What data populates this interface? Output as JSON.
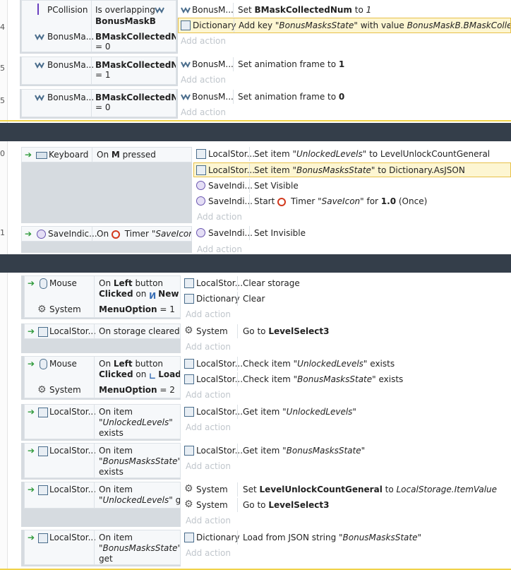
{
  "line_numbers": [
    "4",
    "5",
    "5",
    "0",
    "1"
  ],
  "blocks": [
    {
      "id": "b1",
      "conditions": [
        {
          "object": "PCollision",
          "text": "Is overlapping",
          "text2": "BonusMaskB"
        },
        {
          "object": "BonusMa...",
          "text": "BMaskCollectedNum",
          "text2": "= 0"
        }
      ],
      "actions": [
        {
          "object": "BonusM...",
          "text_pre": "Set ",
          "bold": "BMaskCollectedNum",
          "text_mid": " to ",
          "italic": "1"
        },
        {
          "object": "Dictionary",
          "text_pre": "Add key ",
          "italic": "\"BonusMasksState\"",
          "text_mid": " with value ",
          "italic2": "BonusMaskB.BMaskCollectedNum"
        }
      ]
    },
    {
      "id": "b2",
      "conditions": [
        {
          "object": "BonusMa...",
          "text": "BMaskCollectedNum",
          "text2": "= 1"
        }
      ],
      "actions": [
        {
          "object": "BonusM...",
          "text_pre": "Set animation frame to ",
          "bold": "1"
        }
      ]
    },
    {
      "id": "b3",
      "conditions": [
        {
          "object": "BonusMa...",
          "text": "BMaskCollectedNum",
          "text2": "= 0"
        }
      ],
      "actions": [
        {
          "object": "BonusM...",
          "text_pre": "Set animation frame to ",
          "bold": "0"
        }
      ]
    },
    {
      "id": "b4",
      "conditions": [
        {
          "object": "Keyboard",
          "text": "On ",
          "bold": "M",
          "text2": " pressed"
        }
      ],
      "actions": [
        {
          "object": "LocalStor...",
          "text_pre": "Set item ",
          "italic": "\"UnlockedLevels\"",
          "text_mid": " to LevelUnlockCountGeneral"
        },
        {
          "object": "LocalStor...",
          "text_pre": "Set item ",
          "italic": "\"BonusMasksState\"",
          "text_mid": " to Dictionary.AsJSON"
        },
        {
          "object": "SaveIndi...",
          "text_pre": "Set Visible"
        },
        {
          "object": "SaveIndi...",
          "text_pre": "Start ",
          "text_mid": " Timer ",
          "italic": "\"SaveIcon\"",
          "text_post": " for ",
          "bold": "1.0",
          "text_end": " (Once)"
        }
      ]
    },
    {
      "id": "b5",
      "conditions": [
        {
          "object": "SaveIndic...",
          "text": "On ",
          "text2": " Timer ",
          "italic": "\"SaveIcon\""
        }
      ],
      "actions": [
        {
          "object": "SaveIndi...",
          "text_pre": "Set Invisible"
        }
      ]
    },
    {
      "id": "b6",
      "conditions": [
        {
          "object": "Mouse",
          "text": "On ",
          "bold": "Left",
          "text2": " button",
          "line2_bold": "Clicked",
          "line2": " on ",
          "line2_bold2": "New"
        },
        {
          "object": "System",
          "bold": "MenuOption",
          "text2": " = 1"
        }
      ],
      "actions": [
        {
          "object": "LocalStor...",
          "text_pre": "Clear storage"
        },
        {
          "object": "Dictionary",
          "text_pre": "Clear"
        }
      ]
    },
    {
      "id": "b7",
      "conditions": [
        {
          "object": "LocalStor...",
          "text": "On storage cleared"
        }
      ],
      "actions": [
        {
          "object": "System",
          "text_pre": "Go to ",
          "bold": "LevelSelect3"
        }
      ]
    },
    {
      "id": "b8",
      "conditions": [
        {
          "object": "Mouse",
          "text": "On ",
          "bold": "Left",
          "text2": " button",
          "line2_bold": "Clicked",
          "line2": " on ",
          "line2_bold2": "Load"
        },
        {
          "object": "System",
          "bold": "MenuOption",
          "text2": " = 2"
        }
      ],
      "actions": [
        {
          "object": "LocalStor...",
          "text_pre": "Check item ",
          "italic": "\"UnlockedLevels\"",
          "text_mid": " exists"
        },
        {
          "object": "LocalStor...",
          "text_pre": "Check item ",
          "italic": "\"BonusMasksState\"",
          "text_mid": " exists"
        }
      ]
    },
    {
      "id": "b9",
      "conditions": [
        {
          "object": "LocalStor...",
          "text": "On item",
          "italic": "\"UnlockedLevels\"",
          "text2": "exists"
        }
      ],
      "actions": [
        {
          "object": "LocalStor...",
          "text_pre": "Get item ",
          "italic": "\"UnlockedLevels\""
        }
      ]
    },
    {
      "id": "b10",
      "conditions": [
        {
          "object": "LocalStor...",
          "text": "On item",
          "italic": "\"BonusMasksState\"",
          "text2": "exists"
        }
      ],
      "actions": [
        {
          "object": "LocalStor...",
          "text_pre": "Get item ",
          "italic": "\"BonusMasksState\""
        }
      ]
    },
    {
      "id": "b11",
      "conditions": [
        {
          "object": "LocalStor...",
          "text": "On item",
          "italic": "\"UnlockedLevels\"",
          "text2": " get"
        }
      ],
      "actions": [
        {
          "object": "System",
          "text_pre": "Set ",
          "bold": "LevelUnlockCountGeneral",
          "text_mid": " to ",
          "italic": "LocalStorage.ItemValue"
        },
        {
          "object": "System",
          "text_pre": "Go to ",
          "bold": "LevelSelect3"
        }
      ]
    },
    {
      "id": "b12",
      "conditions": [
        {
          "object": "LocalStor...",
          "text": "On item",
          "italic": "\"BonusMasksState\"",
          "text2": "get"
        }
      ],
      "actions": [
        {
          "object": "Dictionary",
          "text_pre": "Load from JSON string ",
          "italic": "\"BonusMasksState\""
        }
      ]
    }
  ],
  "add_action_label": "Add action",
  "colors": {
    "group_bar": "#343e4a",
    "highlight": "#fdf6d2",
    "highlight_border": "#e8c14a",
    "band": "#d6dbe0"
  }
}
